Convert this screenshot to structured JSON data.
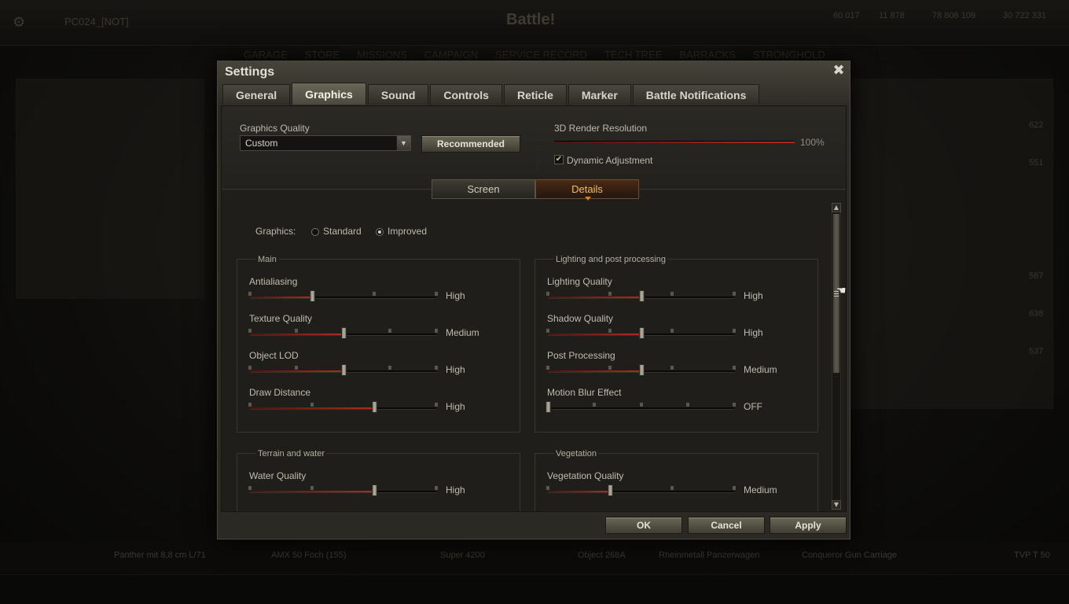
{
  "background": {
    "player_name": "PC024_[NOT]",
    "battle_label": "Battle!",
    "nav_items": [
      "GARAGE",
      "STORE",
      "MISSIONS",
      "CAMPAIGN",
      "SERVICE RECORD",
      "TECH TREE",
      "BARRACKS",
      "STRONGHOLD"
    ],
    "currency": [
      "60 017",
      "11 878",
      "78 808 109",
      "30 722 331"
    ],
    "carousel_vehicles": [
      "Panther mit 8,8 cm L/71",
      "AMX 50 Foch (155)",
      "Super 4200",
      "Object 268A",
      "Rheinmetall Panzerwagen",
      "Conqueror Gun Carriage",
      "TVP T 50"
    ],
    "side_values": [
      "622",
      "551",
      "567",
      "638",
      "537"
    ]
  },
  "dialog": {
    "title": "Settings",
    "close_icon": "close-icon",
    "tabs": [
      {
        "label": "General",
        "active": false
      },
      {
        "label": "Graphics",
        "active": true
      },
      {
        "label": "Sound",
        "active": false
      },
      {
        "label": "Controls",
        "active": false
      },
      {
        "label": "Reticle",
        "active": false
      },
      {
        "label": "Marker",
        "active": false
      },
      {
        "label": "Battle Notifications",
        "active": false
      }
    ],
    "graphics_quality": {
      "label": "Graphics Quality",
      "value": "Custom",
      "recommended_label": "Recommended"
    },
    "render_resolution": {
      "label": "3D Render Resolution",
      "value": "100%",
      "fraction": 1.0
    },
    "dynamic_adjustment": {
      "label": "Dynamic Adjustment",
      "checked": true
    },
    "subtabs": [
      {
        "label": "Screen",
        "active": false
      },
      {
        "label": "Details",
        "active": true
      }
    ],
    "graphics_mode": {
      "label": "Graphics:",
      "options": [
        "Standard",
        "Improved"
      ],
      "selected": "Improved"
    },
    "groups": {
      "main": {
        "title": "Main",
        "settings": [
          {
            "label": "Antialiasing",
            "value": "High",
            "steps": 4,
            "level": 1
          },
          {
            "label": "Texture Quality",
            "value": "Medium",
            "steps": 5,
            "level": 2
          },
          {
            "label": "Object LOD",
            "value": "High",
            "steps": 5,
            "level": 2
          },
          {
            "label": "Draw Distance",
            "value": "High",
            "steps": 4,
            "level": 2
          }
        ]
      },
      "lighting": {
        "title": "Lighting and post processing",
        "settings": [
          {
            "label": "Lighting Quality",
            "value": "High",
            "steps": 4,
            "level": 1.5
          },
          {
            "label": "Shadow Quality",
            "value": "High",
            "steps": 4,
            "level": 1.5
          },
          {
            "label": "Post Processing",
            "value": "Medium",
            "steps": 4,
            "level": 1.5
          },
          {
            "label": "Motion Blur Effect",
            "value": "OFF",
            "steps": 5,
            "level": 0
          }
        ]
      },
      "terrain": {
        "title": "Terrain and water",
        "settings": [
          {
            "label": "Water Quality",
            "value": "High",
            "steps": 4,
            "level": 2
          }
        ]
      },
      "vegetation": {
        "title": "Vegetation",
        "settings": [
          {
            "label": "Vegetation Quality",
            "value": "Medium",
            "steps": 4,
            "level": 1
          }
        ]
      }
    },
    "buttons": {
      "ok": "OK",
      "cancel": "Cancel",
      "apply": "Apply"
    }
  }
}
